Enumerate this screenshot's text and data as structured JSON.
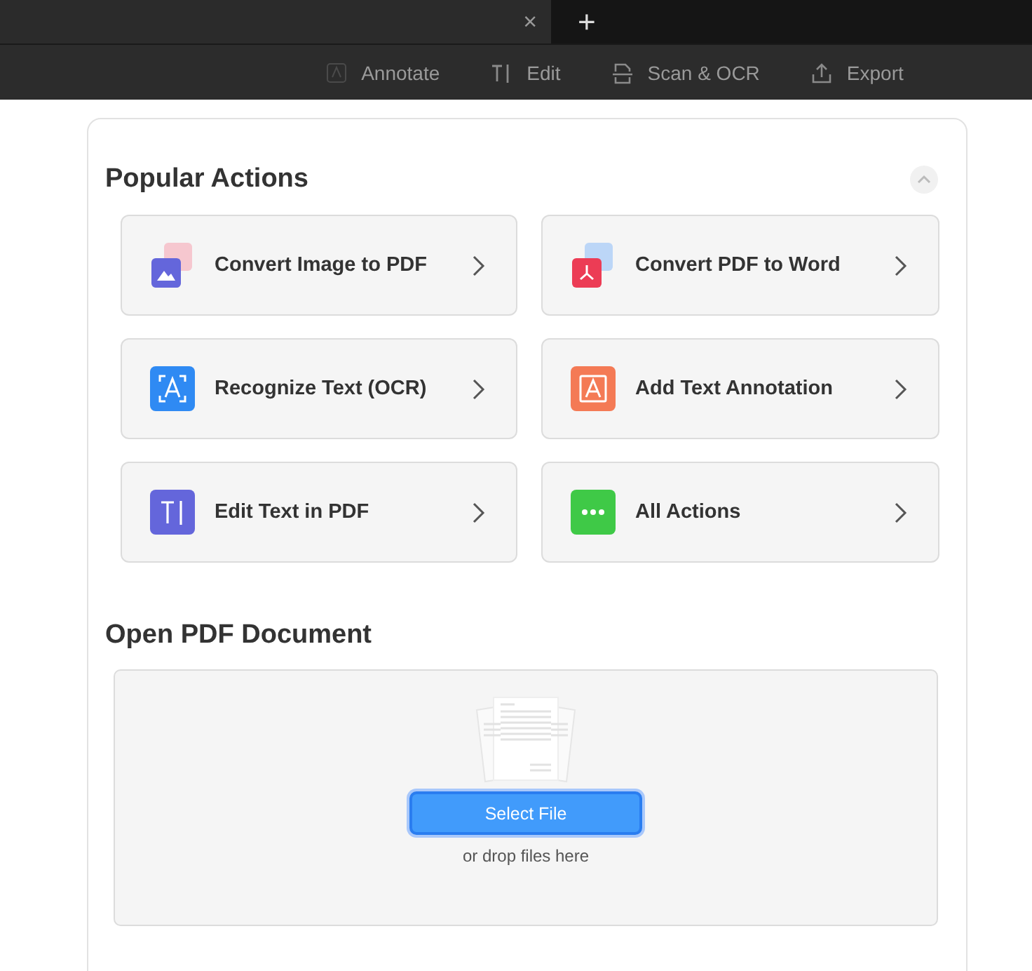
{
  "tab_bar": {
    "close_label": "×",
    "new_tab_label": "+"
  },
  "toolbar": [
    {
      "kind": "annotate",
      "label": "Annotate"
    },
    {
      "kind": "edit",
      "label": "Edit"
    },
    {
      "kind": "scan",
      "label": "Scan & OCR"
    },
    {
      "kind": "export",
      "label": "Export"
    }
  ],
  "popular_actions": {
    "title": "Popular Actions",
    "expanded": true,
    "actions": [
      {
        "kind": "image-to-pdf",
        "label": "Convert Image to PDF"
      },
      {
        "kind": "pdf-to-word",
        "label": "Convert PDF to Word"
      },
      {
        "kind": "ocr",
        "label": "Recognize Text (OCR)"
      },
      {
        "kind": "annotation",
        "label": "Add Text Annotation"
      },
      {
        "kind": "edit-text",
        "label": "Edit Text in PDF"
      },
      {
        "kind": "all",
        "label": "All Actions"
      }
    ]
  },
  "open_document": {
    "title": "Open PDF Document",
    "button": "Select File",
    "hint": "or drop files here"
  }
}
